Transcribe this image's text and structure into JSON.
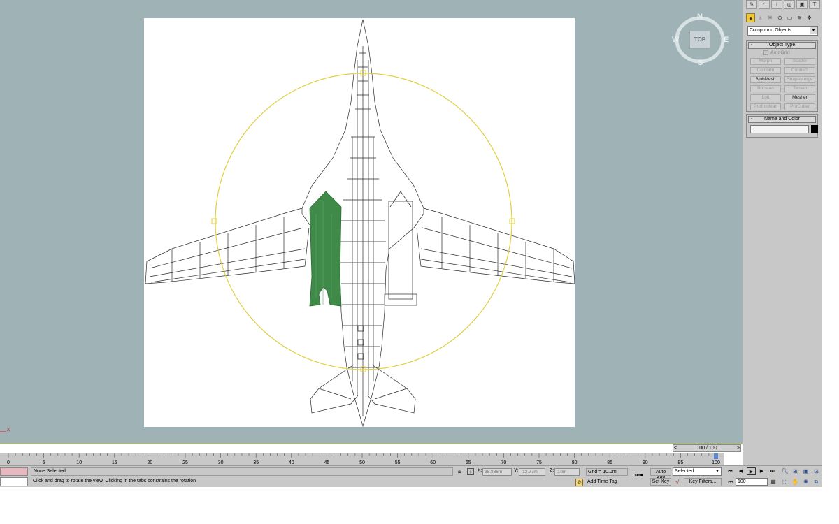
{
  "viewcube": {
    "n": "N",
    "s": "S",
    "e": "E",
    "w": "W",
    "face": "TOP"
  },
  "command_panel": {
    "tab_icons": [
      "create-icon",
      "modify-icon",
      "hierarchy-icon",
      "motion-icon",
      "display-icon",
      "utilities-icon"
    ],
    "category_icons": [
      "geometry-icon",
      "shapes-icon",
      "lights-icon",
      "cameras-icon",
      "helpers-icon",
      "spacewarps-icon",
      "systems-icon"
    ],
    "category_dropdown": "Compound Objects",
    "object_type": {
      "title": "Object Type",
      "autogrid": "AutoGrid",
      "buttons": [
        {
          "label": "Morph",
          "enabled": false
        },
        {
          "label": "Scatter",
          "enabled": false
        },
        {
          "label": "Conform",
          "enabled": false
        },
        {
          "label": "Connect",
          "enabled": false
        },
        {
          "label": "BlobMesh",
          "enabled": true
        },
        {
          "label": "ShapeMerge",
          "enabled": false
        },
        {
          "label": "Boolean",
          "enabled": false
        },
        {
          "label": "Terrain",
          "enabled": false
        },
        {
          "label": "Loft",
          "enabled": false
        },
        {
          "label": "Mesher",
          "enabled": true
        },
        {
          "label": "ProBoolean",
          "enabled": false
        },
        {
          "label": "ProCutter",
          "enabled": false
        }
      ]
    },
    "name_and_color": {
      "title": "Name and Color",
      "name": "",
      "color": "#000000"
    }
  },
  "time_slider": {
    "label": "100 / 100",
    "left_arrow": "<",
    "right_arrow": ">"
  },
  "trackbar": {
    "labels": [
      "0",
      "5",
      "10",
      "15",
      "20",
      "25",
      "30",
      "35",
      "40",
      "45",
      "50",
      "55",
      "60",
      "65",
      "70",
      "75",
      "80",
      "85",
      "90",
      "95",
      "100"
    ],
    "current_frame": 100
  },
  "status": {
    "selection": "None Selected",
    "prompt": "Click and drag to rotate the view.  Clicking in the tabs constrains the rotation",
    "x_label": "X:",
    "x_value": "38.886m",
    "y_label": "Y:",
    "y_value": "-13.77m",
    "z_label": "Z:",
    "z_value": "0.0m",
    "grid": "Grid = 10.0m",
    "add_time_tag": "Add Time Tag",
    "auto_key": "Auto Key",
    "set_key": "Set Key",
    "selected_dropdown": "Selected",
    "key_filters": "Key Filters...",
    "frame_value": "100"
  },
  "colors": {
    "viewport_bg": "#9fb3b6",
    "gizmo": "#e0d040",
    "mesh_green": "#3f8a48",
    "active_tab": "#f0c838"
  }
}
